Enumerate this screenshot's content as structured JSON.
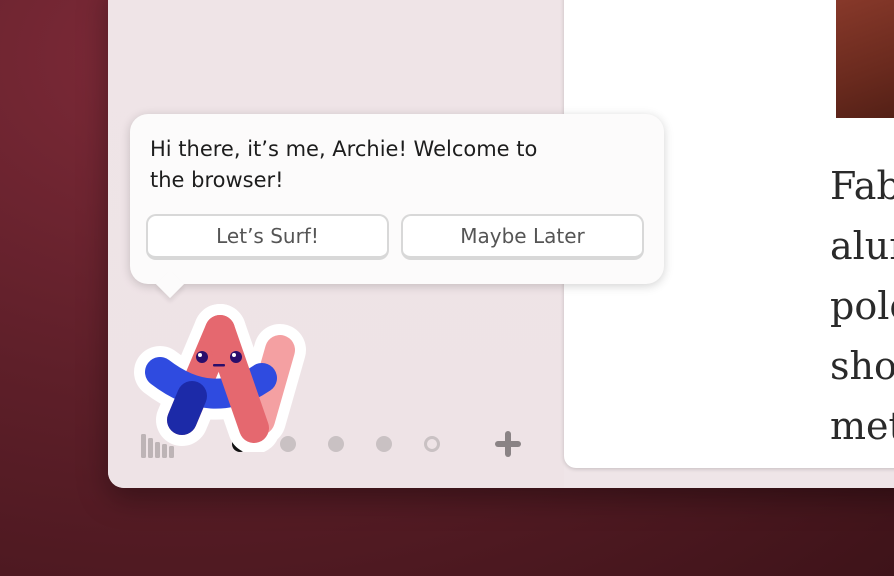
{
  "onboarding": {
    "message": "Hi there, it’s me, Archie! Welcome to the browser!",
    "primary_button": "Let’s Surf!",
    "secondary_button": "Maybe Later",
    "mascot_icon": "archie-mascot-icon"
  },
  "article": {
    "lines": [
      "Fab",
      "alum",
      "pole",
      "shor",
      "met"
    ]
  },
  "sidebar": {
    "library_icon": "library-icon",
    "spaces": [
      {
        "state": "active"
      },
      {
        "state": "inactive"
      },
      {
        "state": "inactive"
      },
      {
        "state": "inactive"
      },
      {
        "state": "empty"
      }
    ],
    "add_icon": "plus-icon"
  },
  "colors": {
    "background": "#5e1f29",
    "sidebar": "#efe4e7",
    "mascot_red": "#e5686f",
    "mascot_blue": "#2f4be0",
    "mascot_pink": "#f4a0a2"
  }
}
